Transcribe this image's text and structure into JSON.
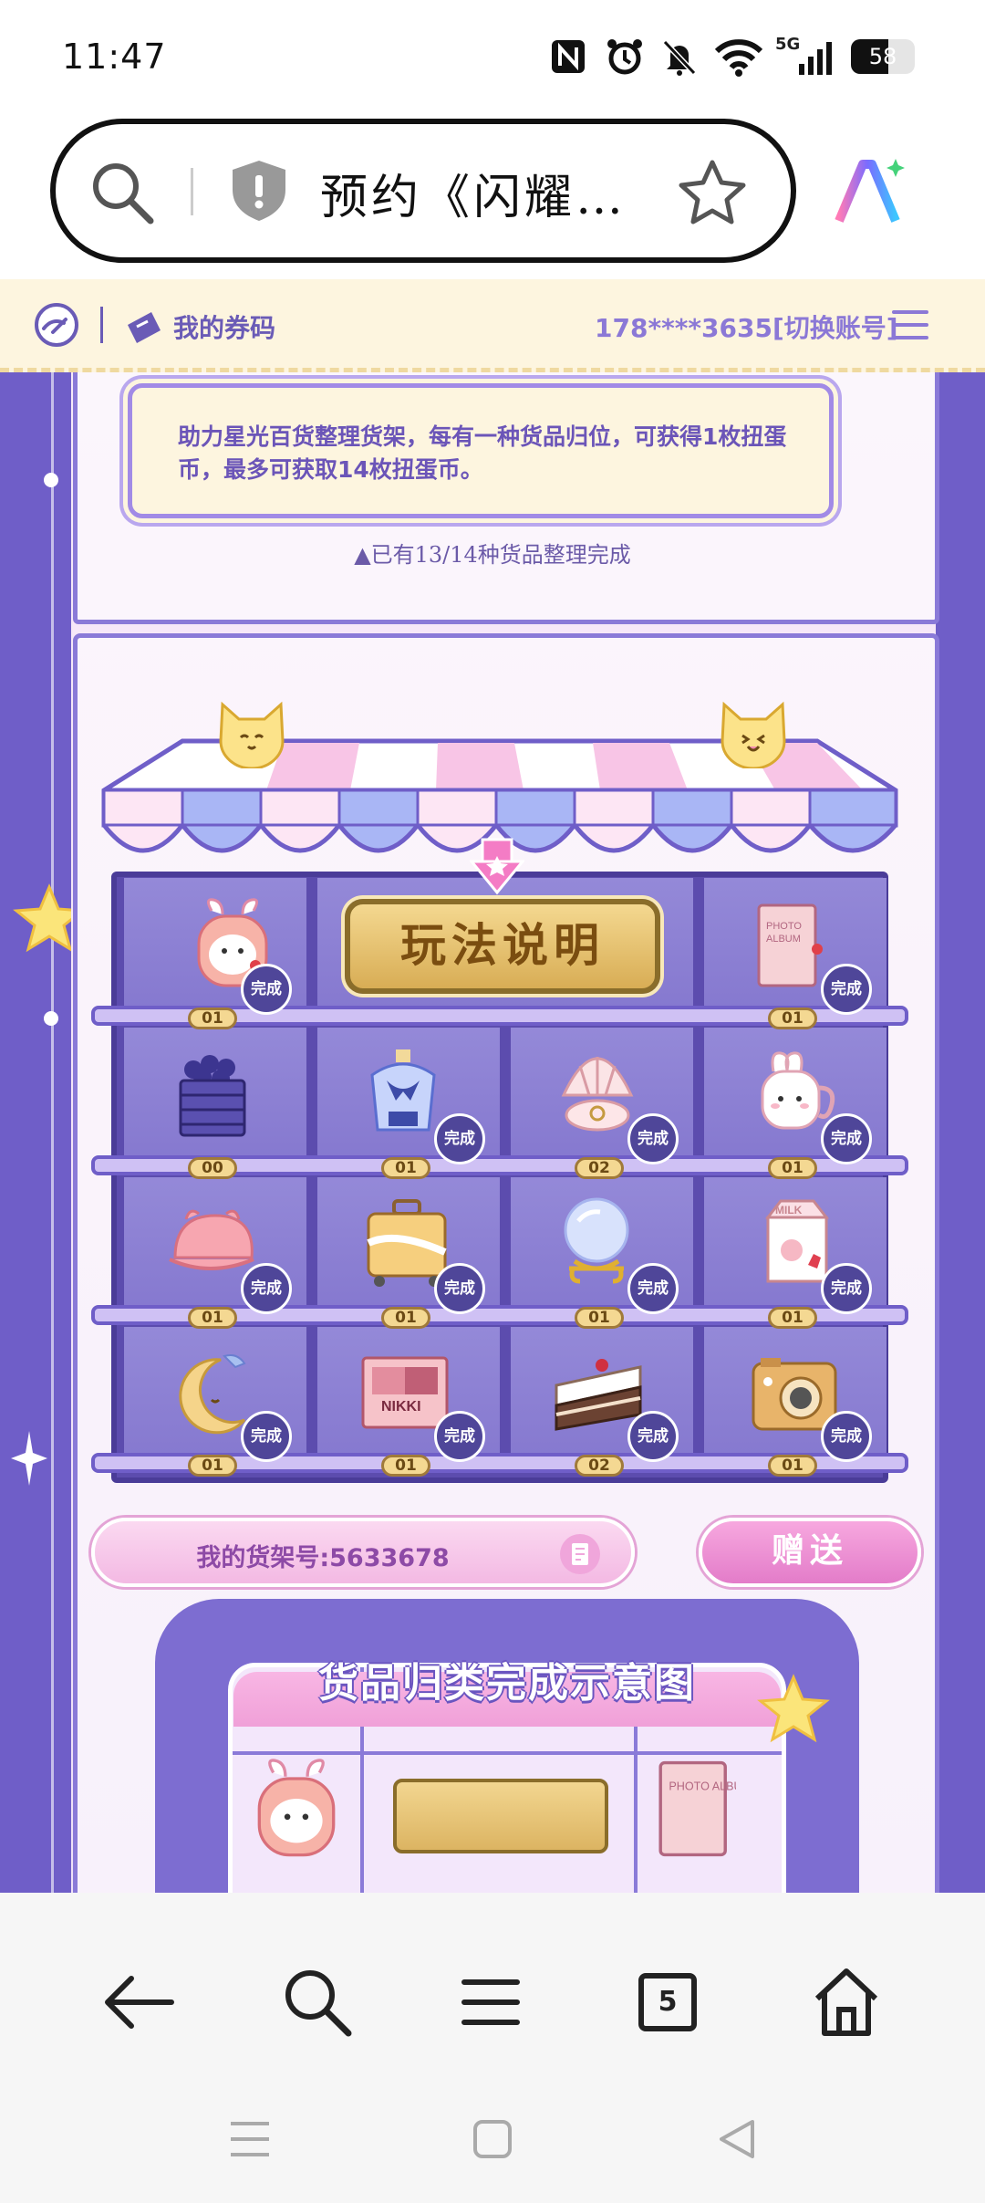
{
  "status_bar": {
    "time": "11:47",
    "battery": "58",
    "network": "5G",
    "icons": [
      "nfc-icon",
      "alarm-icon",
      "mute-icon",
      "wifi-icon",
      "signal-icon",
      "battery-icon"
    ]
  },
  "browser": {
    "url_title": "预约《闪耀…",
    "icons": [
      "search-icon",
      "shield-icon",
      "star-icon",
      "ai-icon"
    ]
  },
  "site_header": {
    "coupon_label": "我的券码",
    "account_label": "178****3635[切换账号]",
    "icons": [
      "home-logo-icon",
      "coupon-icon",
      "menu-icon"
    ]
  },
  "game": {
    "info_text": "助力星光百货整理货架，每有一种货品归位，可获得1枚扭蛋币，最多可获取14枚扭蛋币。",
    "progress_text": "▲已有13/14种货品整理完成",
    "howto_label": "玩法说明",
    "done_label": "完成",
    "shelf": [
      [
        {
          "item": "rabbit-backpack",
          "count": "01",
          "done": true
        },
        {
          "item": "howto",
          "count": "",
          "done": false
        },
        {
          "item": "howto",
          "count": "",
          "done": false
        },
        {
          "item": "photo-album",
          "count": "01",
          "done": true
        }
      ],
      [
        {
          "item": "grape-basket",
          "count": "00",
          "done": false
        },
        {
          "item": "perfume-bottle",
          "count": "01",
          "done": true
        },
        {
          "item": "shell-ring",
          "count": "02",
          "done": true
        },
        {
          "item": "bunny-mug",
          "count": "01",
          "done": true
        }
      ],
      [
        {
          "item": "pink-cap",
          "count": "01",
          "done": true
        },
        {
          "item": "suitcase",
          "count": "01",
          "done": true
        },
        {
          "item": "crystal-ball",
          "count": "01",
          "done": true
        },
        {
          "item": "milk-carton",
          "count": "01",
          "done": true
        }
      ],
      [
        {
          "item": "moon-pillow",
          "count": "01",
          "done": true
        },
        {
          "item": "nikki-palette",
          "count": "01",
          "done": true
        },
        {
          "item": "cake-slice",
          "count": "02",
          "done": true
        },
        {
          "item": "camera",
          "count": "01",
          "done": true
        }
      ]
    ],
    "nikki_text": "NIKKI",
    "album_text": "PHOTO ALBUM",
    "milk_text": "MILK",
    "shelf_id_label": "我的货架号:5633678",
    "gift_label": "赠送",
    "preview_title": "货品归类完成示意图"
  },
  "bottom_nav": {
    "tab_count": "5",
    "icons": [
      "back-icon",
      "search-icon",
      "menu-icon",
      "tabs-icon",
      "home-icon"
    ]
  },
  "system_nav": {
    "icons": [
      "recents-icon",
      "home-square-icon",
      "back-triangle-icon"
    ]
  }
}
